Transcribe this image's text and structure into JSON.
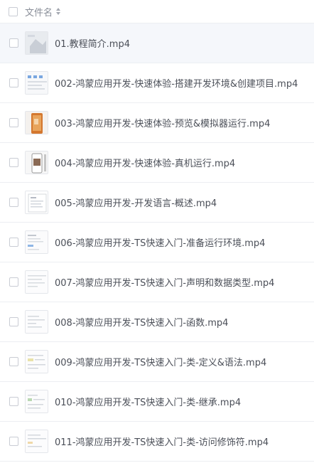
{
  "header": {
    "column_label": "文件名"
  },
  "files": [
    {
      "name": "01.教程简介.mp4",
      "thumb": "tutorial-intro-thumbnail"
    },
    {
      "name": "002-鸿蒙应用开发-快速体验-搭建开发环境&创建项目.mp4",
      "thumb": "setup-env-thumbnail"
    },
    {
      "name": "003-鸿蒙应用开发-快速体验-预览&模拟器运行.mp4",
      "thumb": "emulator-thumbnail"
    },
    {
      "name": "004-鸿蒙应用开发-快速体验-真机运行.mp4",
      "thumb": "device-run-thumbnail"
    },
    {
      "name": "005-鸿蒙应用开发-开发语言-概述.mp4",
      "thumb": "language-overview-thumbnail"
    },
    {
      "name": "006-鸿蒙应用开发-TS快速入门-准备运行环境.mp4",
      "thumb": "ts-env-thumbnail"
    },
    {
      "name": "007-鸿蒙应用开发-TS快速入门-声明和数据类型.mp4",
      "thumb": "ts-types-thumbnail"
    },
    {
      "name": "008-鸿蒙应用开发-TS快速入门-函数.mp4",
      "thumb": "ts-function-thumbnail"
    },
    {
      "name": "009-鸿蒙应用开发-TS快速入门-类-定义&语法.mp4",
      "thumb": "ts-class-thumbnail"
    },
    {
      "name": "010-鸿蒙应用开发-TS快速入门-类-继承.mp4",
      "thumb": "ts-inherit-thumbnail"
    },
    {
      "name": "011-鸿蒙应用开发-TS快速入门-类-访问修饰符.mp4",
      "thumb": "ts-modifier-thumbnail"
    }
  ]
}
